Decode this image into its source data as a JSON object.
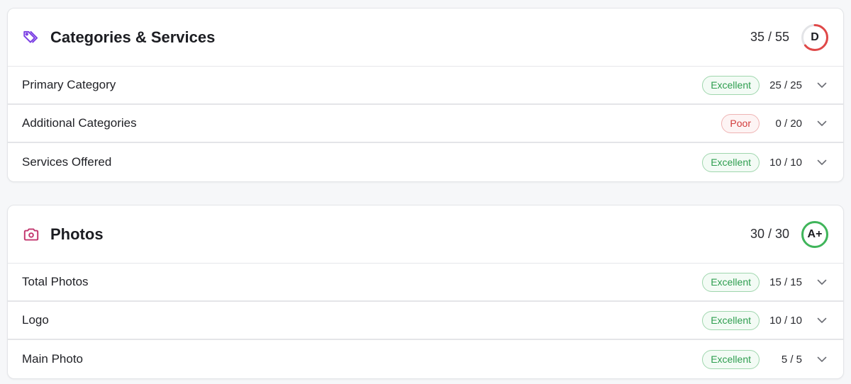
{
  "colors": {
    "good": "#2e9e4f",
    "poor": "#d23b3b",
    "tag_icon": "#7b3fe4",
    "camera_icon": "#c2366e",
    "grade_track": "#e3e4e7"
  },
  "sections": [
    {
      "title": "Categories & Services",
      "icon": "tag-icon",
      "score": "35 / 55",
      "grade": "D",
      "grade_fraction": 0.64,
      "grade_color": "#e04848",
      "rows": [
        {
          "label": "Primary Category",
          "status": "Excellent",
          "status_kind": "good",
          "score": "25 / 25"
        },
        {
          "label": "Additional Categories",
          "status": "Poor",
          "status_kind": "poor",
          "score": "0 / 20"
        },
        {
          "label": "Services Offered",
          "status": "Excellent",
          "status_kind": "good",
          "score": "10 / 10"
        }
      ]
    },
    {
      "title": "Photos",
      "icon": "camera-icon",
      "score": "30 / 30",
      "grade": "A+",
      "grade_fraction": 1.0,
      "grade_color": "#3fb55a",
      "rows": [
        {
          "label": "Total Photos",
          "status": "Excellent",
          "status_kind": "good",
          "score": "15 / 15"
        },
        {
          "label": "Logo",
          "status": "Excellent",
          "status_kind": "good",
          "score": "10 / 10"
        },
        {
          "label": "Main Photo",
          "status": "Excellent",
          "status_kind": "good",
          "score": "5 / 5"
        }
      ]
    }
  ]
}
